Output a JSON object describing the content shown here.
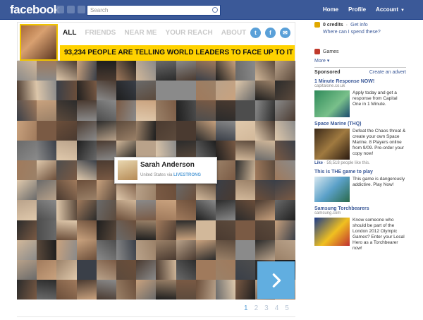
{
  "topbar": {
    "logo": "facebook",
    "search_placeholder": "Search",
    "nav": [
      {
        "label": "Home"
      },
      {
        "label": "Profile"
      },
      {
        "label": "Account"
      }
    ]
  },
  "app": {
    "tabs": [
      {
        "label": "ALL",
        "active": true
      },
      {
        "label": "FRIENDS",
        "active": false
      },
      {
        "label": "NEAR ME",
        "active": false
      },
      {
        "label": "YOUR REACH",
        "active": false
      },
      {
        "label": "ABOUT",
        "active": false
      }
    ],
    "social": {
      "twitter": "t",
      "facebook": "f",
      "email": "✉"
    },
    "banner": "93,234 PEOPLE ARE TELLING WORLD LEADERS TO FACE UP TO IT",
    "profile_card": {
      "name": "Sarah Anderson",
      "location": "United States",
      "via": "via",
      "source": "LIVESTRONG"
    },
    "next_icon": "chevron-right-icon",
    "pager": [
      "1",
      "2",
      "3",
      "4",
      "5"
    ],
    "pager_current": "1"
  },
  "sidebar": {
    "credits": "0 credits",
    "get_info": "Get info",
    "where_spend": "Where can I spend these?",
    "games": "Games",
    "more": "More",
    "sponsored": "Sponsored",
    "create_advert": "Create an advert",
    "ads": [
      {
        "title": "1 Minute Response NOW!",
        "domain": "capitalone.co.uk",
        "body": "Apply today and get a response from Capital One in 1 Minute.",
        "like": null
      },
      {
        "title": "Space Marine (THQ)",
        "domain": "",
        "body": "Defeat the Chaos threat & create your own Space Marine. 8 Players online from 9/09. Pre-order your copy now!",
        "like": "Like",
        "like_count": "59,518 people like this."
      },
      {
        "title": "This is THE game to play",
        "domain": "",
        "body": "This game is dangerously addictive. Play Now!",
        "like": null
      },
      {
        "title": "Samsung Torchbearers",
        "domain": "samsung.com",
        "body": "Know someone who should be part of the London 2012 Olympic Games? Enter your Local Hero as a Torchbearer now!",
        "like": null
      }
    ]
  },
  "colors": {
    "facebook_blue": "#3b5998",
    "banner_yellow": "#ffd200",
    "accent_blue": "#61aee0"
  }
}
